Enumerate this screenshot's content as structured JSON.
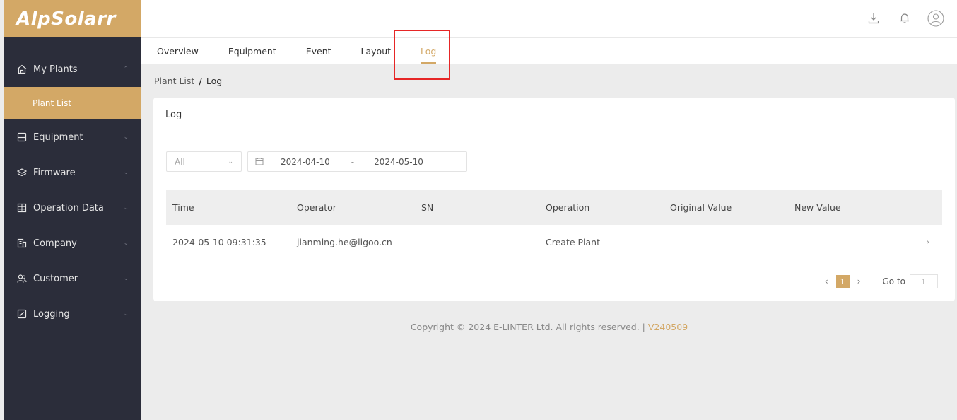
{
  "app": {
    "logo_text": "AlpSolarr",
    "brand_color": "#d3a866"
  },
  "topbar": {
    "icons": [
      "download-icon",
      "bell-icon",
      "user-avatar-icon"
    ]
  },
  "sidebar": {
    "items": [
      {
        "label": "My Plants",
        "icon": "home-icon",
        "expanded": true
      },
      {
        "label": "Equipment",
        "icon": "equipment-icon"
      },
      {
        "label": "Firmware",
        "icon": "firmware-icon"
      },
      {
        "label": "Operation Data",
        "icon": "table-icon"
      },
      {
        "label": "Company",
        "icon": "company-icon"
      },
      {
        "label": "Customer",
        "icon": "customer-icon"
      },
      {
        "label": "Logging",
        "icon": "edit-icon"
      }
    ],
    "submenu_active": "Plant List"
  },
  "tabs": [
    {
      "label": "Overview"
    },
    {
      "label": "Equipment"
    },
    {
      "label": "Event"
    },
    {
      "label": "Layout"
    },
    {
      "label": "Log",
      "active": true
    }
  ],
  "breadcrumb": {
    "parent": "Plant List",
    "separator": "/",
    "current": "Log"
  },
  "card": {
    "title": "Log"
  },
  "filter": {
    "select_value": "All",
    "date_start": "2024-04-10",
    "date_sep": "-",
    "date_end": "2024-05-10"
  },
  "table": {
    "headers": [
      "Time",
      "Operator",
      "SN",
      "Operation",
      "Original Value",
      "New Value"
    ],
    "rows": [
      [
        "2024-05-10 09:31:35",
        "jianming.he@ligoo.cn",
        "--",
        "Create Plant",
        "--",
        "--"
      ]
    ]
  },
  "pagination": {
    "current_page": "1",
    "goto_label": "Go to",
    "goto_value": "1"
  },
  "footer": {
    "text": "Copyright © 2024 E-LINTER Ltd. All rights reserved. |",
    "version": "V240509"
  }
}
